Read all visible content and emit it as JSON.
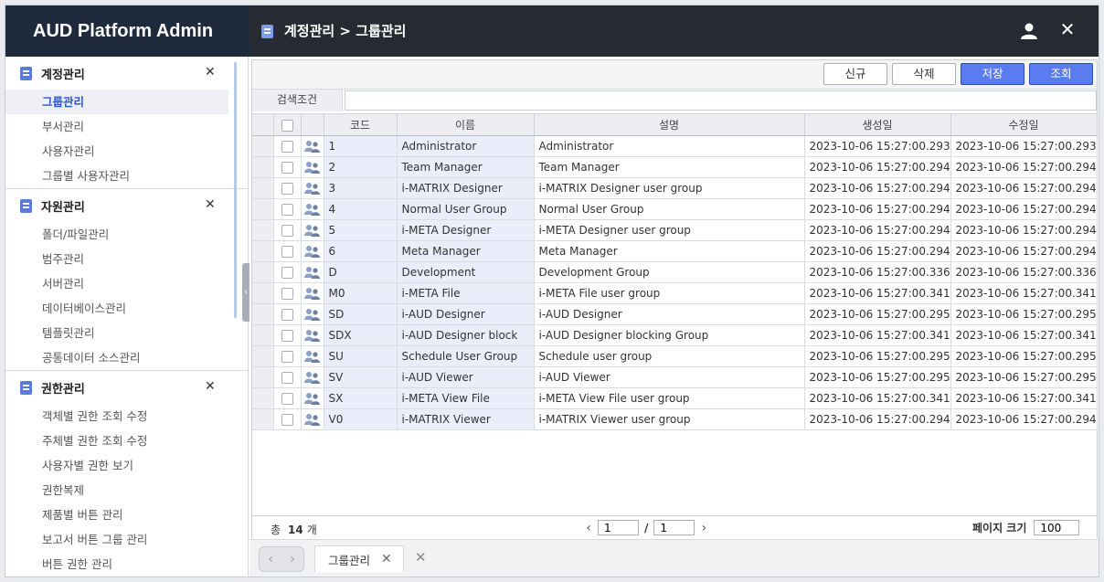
{
  "app": {
    "brand": "AUD Platform Admin",
    "breadcrumb": "계정관리 > 그룹관리",
    "icons": {
      "user": "user-icon",
      "close": "close-icon"
    }
  },
  "sidebar": {
    "groups": [
      {
        "title": "계정관리",
        "items": [
          "그룹관리",
          "부서관리",
          "사용자관리",
          "그룹별 사용자관리"
        ],
        "active": 0
      },
      {
        "title": "자원관리",
        "items": [
          "폴더/파일관리",
          "범주관리",
          "서버관리",
          "데이터베이스관리",
          "템플릿관리",
          "공통데이터 소스관리"
        ]
      },
      {
        "title": "권한관리",
        "items": [
          "객체별 권한 조회 수정",
          "주체별 권한 조회 수정",
          "사용자별 권한 보기",
          "권한복제",
          "제품별 버튼 관리",
          "보고서 버튼 그룹 관리",
          "버튼 권한 관리"
        ]
      }
    ]
  },
  "toolbar": {
    "new": "신규",
    "delete": "삭제",
    "save": "저장",
    "search": "조회"
  },
  "search": {
    "label": "검색조건",
    "value": ""
  },
  "grid": {
    "columns": [
      "코드",
      "이름",
      "설명",
      "생성일",
      "수정일"
    ],
    "rows": [
      [
        "1",
        "Administrator",
        "Administrator",
        "2023-10-06 15:27:00.293",
        "2023-10-06 15:27:00.293"
      ],
      [
        "2",
        "Team Manager",
        "Team Manager",
        "2023-10-06 15:27:00.294",
        "2023-10-06 15:27:00.294"
      ],
      [
        "3",
        "i-MATRIX Designer",
        "i-MATRIX Designer user group",
        "2023-10-06 15:27:00.294",
        "2023-10-06 15:27:00.294"
      ],
      [
        "4",
        "Normal User Group",
        "Normal User Group",
        "2023-10-06 15:27:00.294",
        "2023-10-06 15:27:00.294"
      ],
      [
        "5",
        "i-META Designer",
        "i-META Designer user group",
        "2023-10-06 15:27:00.294",
        "2023-10-06 15:27:00.294"
      ],
      [
        "6",
        "Meta Manager",
        "Meta Manager",
        "2023-10-06 15:27:00.294",
        "2023-10-06 15:27:00.294"
      ],
      [
        "D",
        "Development",
        "Development Group",
        "2023-10-06 15:27:00.336",
        "2023-10-06 15:27:00.336"
      ],
      [
        "M0",
        "i-META File",
        "i-META File user group",
        "2023-10-06 15:27:00.341",
        "2023-10-06 15:27:00.341"
      ],
      [
        "SD",
        "i-AUD Designer",
        "i-AUD Designer",
        "2023-10-06 15:27:00.295",
        "2023-10-06 15:27:00.295"
      ],
      [
        "SDX",
        "i-AUD Designer block",
        "i-AUD Designer blocking Group",
        "2023-10-06 15:27:00.341",
        "2023-10-06 15:27:00.341"
      ],
      [
        "SU",
        "Schedule User Group",
        "Schedule user group",
        "2023-10-06 15:27:00.295",
        "2023-10-06 15:27:00.295"
      ],
      [
        "SV",
        "i-AUD Viewer",
        "i-AUD Viewer",
        "2023-10-06 15:27:00.295",
        "2023-10-06 15:27:00.295"
      ],
      [
        "SX",
        "i-META View File",
        "i-META View File user group",
        "2023-10-06 15:27:00.341",
        "2023-10-06 15:27:00.341"
      ],
      [
        "V0",
        "i-MATRIX Viewer",
        "i-MATRIX Viewer user group",
        "2023-10-06 15:27:00.294",
        "2023-10-06 15:27:00.294"
      ]
    ]
  },
  "footer": {
    "total_prefix": "총",
    "total_count": "14",
    "total_suffix": "개",
    "page": "1",
    "page_total": "1",
    "page_sep": "/",
    "page_size_label": "페이지 크기",
    "page_size": "100"
  },
  "tabs": {
    "items": [
      {
        "label": "그룹관리"
      }
    ]
  },
  "colors": {
    "header_bg": "#262b33",
    "brand_bg": "#1f2a3d",
    "primary": "#5b7cf0",
    "active_text": "#2b55d6",
    "row_highlight": "#eaedfa"
  }
}
